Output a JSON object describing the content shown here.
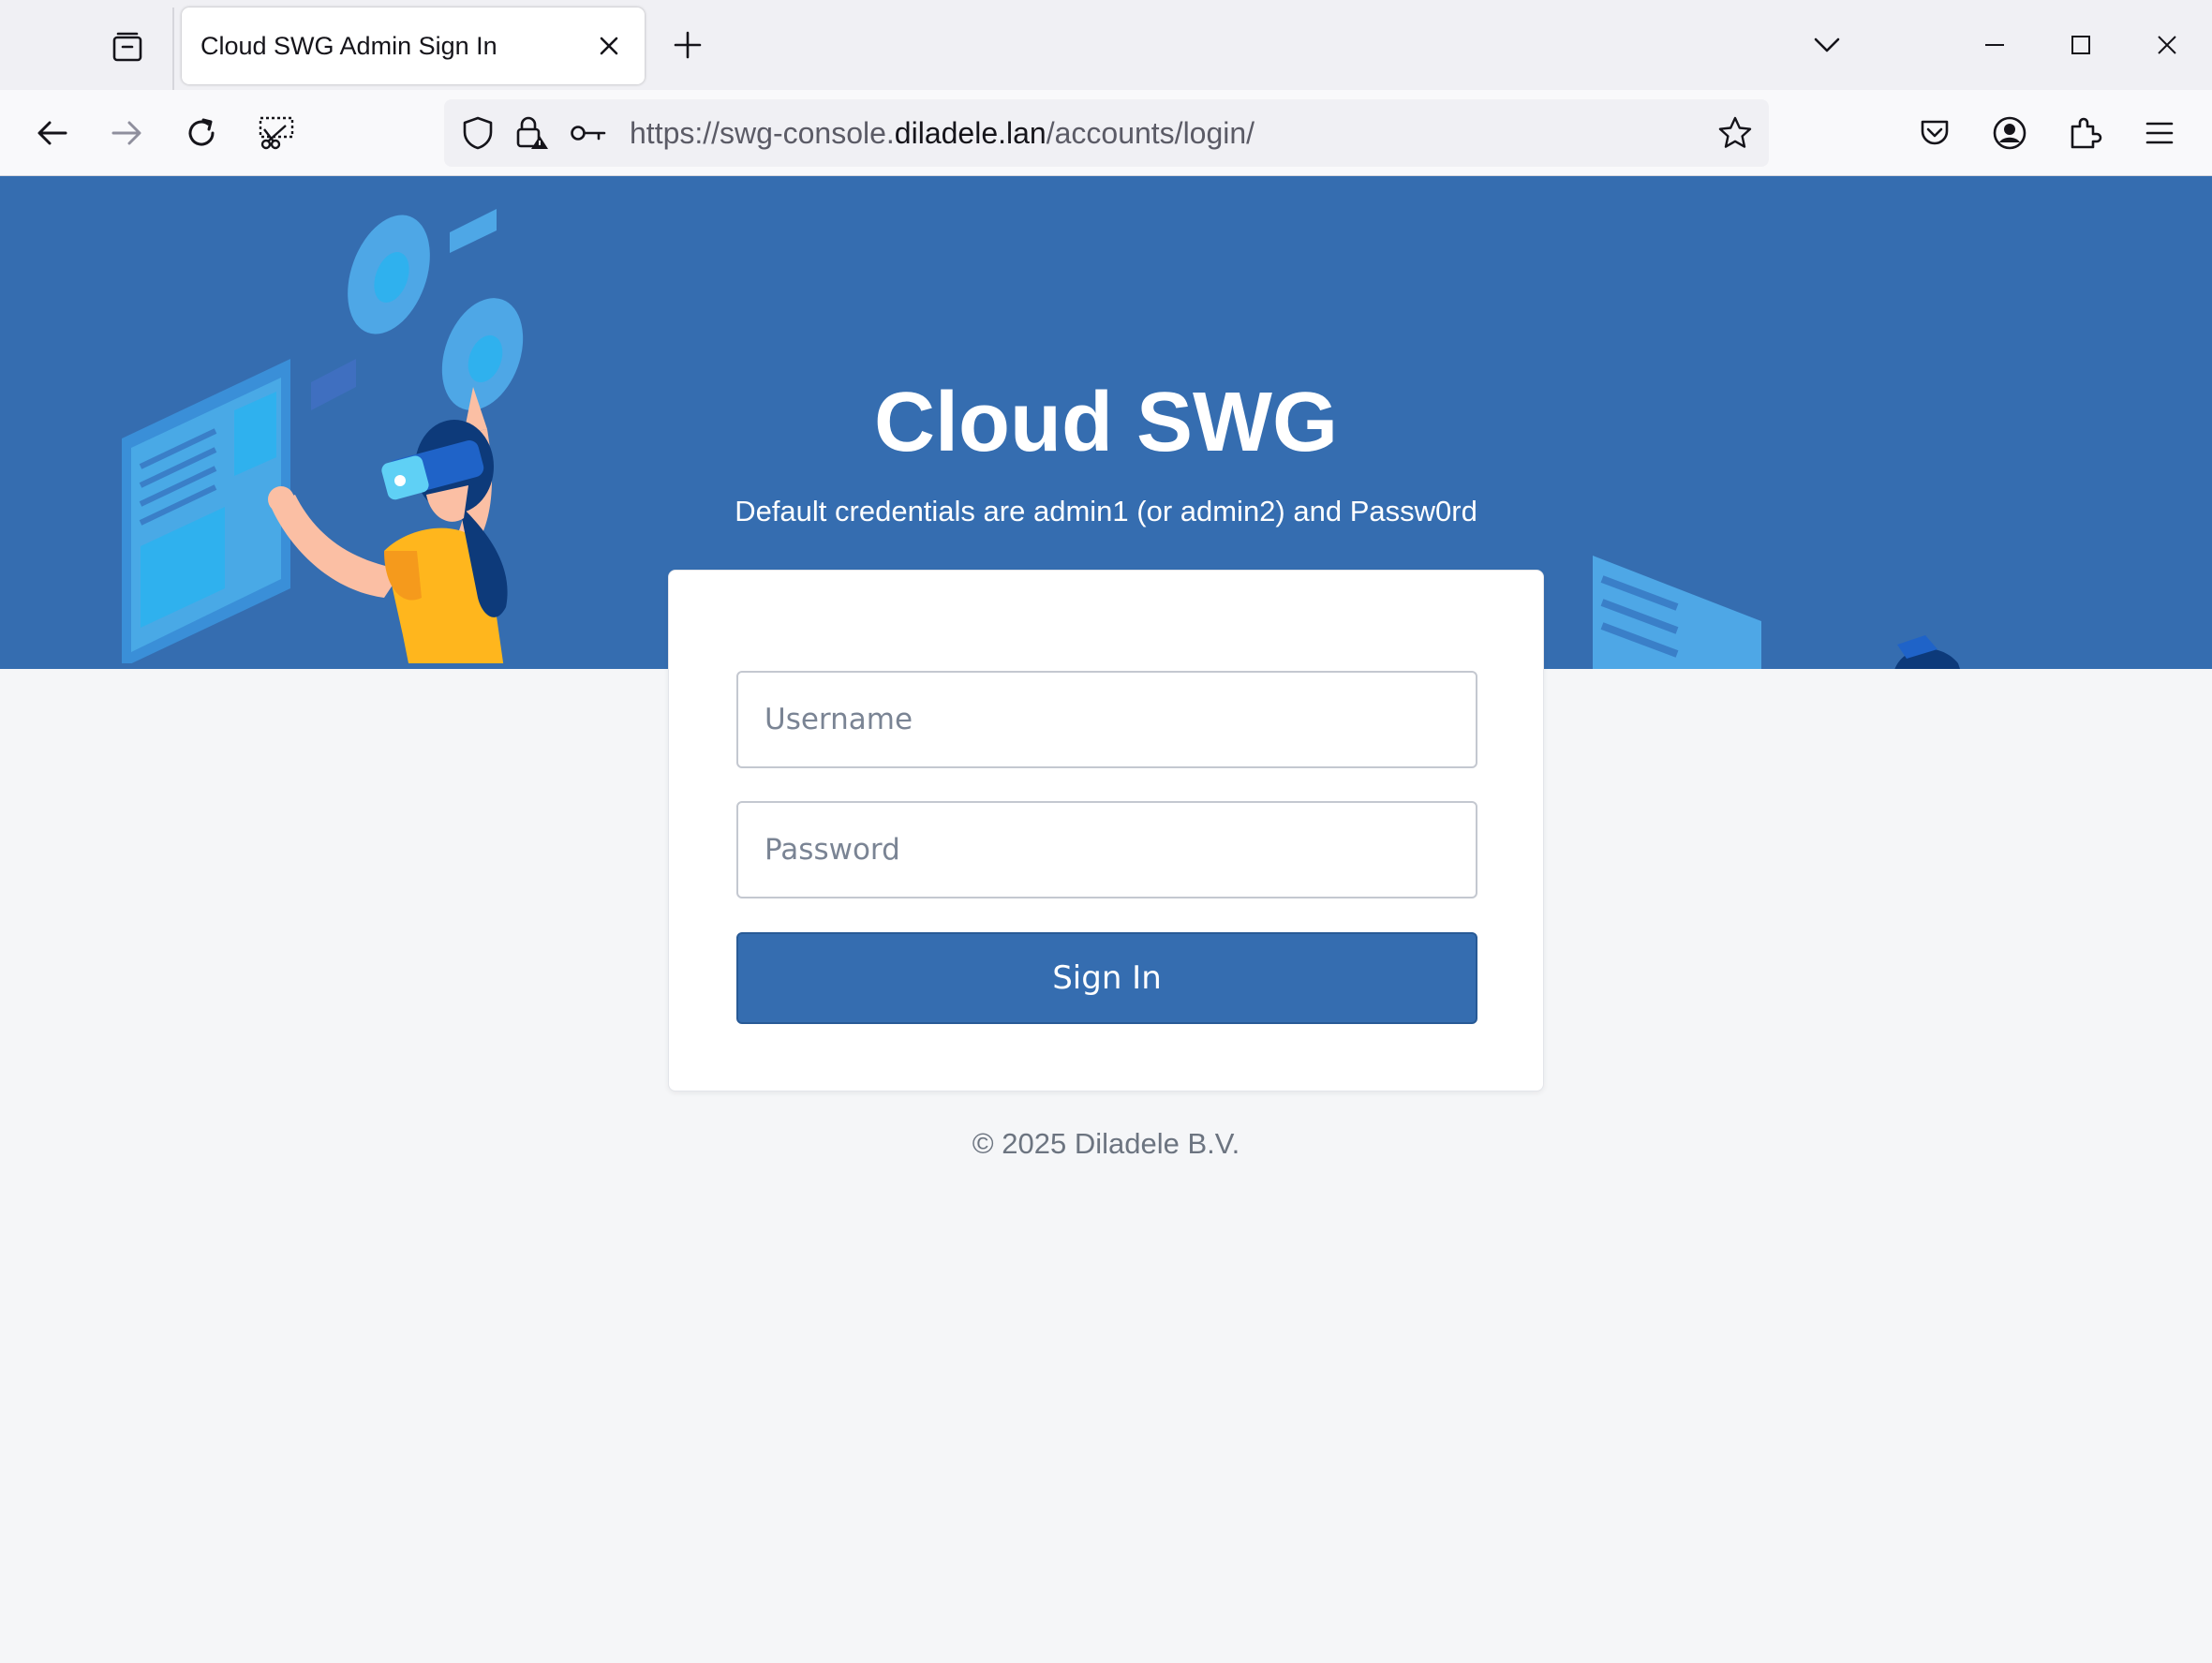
{
  "tab": {
    "title": "Cloud SWG Admin Sign In"
  },
  "address": {
    "prefix": "https://swg-console.",
    "host": "diladele.lan",
    "path": "/accounts/login/"
  },
  "hero": {
    "title": "Cloud SWG",
    "subtitle": "Default credentials are admin1 (or admin2) and Passw0rd"
  },
  "form": {
    "username_placeholder": "Username",
    "password_placeholder": "Password",
    "submit_label": "Sign In"
  },
  "footer": {
    "copyright": "© 2025 Diladele B.V."
  },
  "colors": {
    "brand": "#356db0",
    "page": "#f5f6f8"
  }
}
